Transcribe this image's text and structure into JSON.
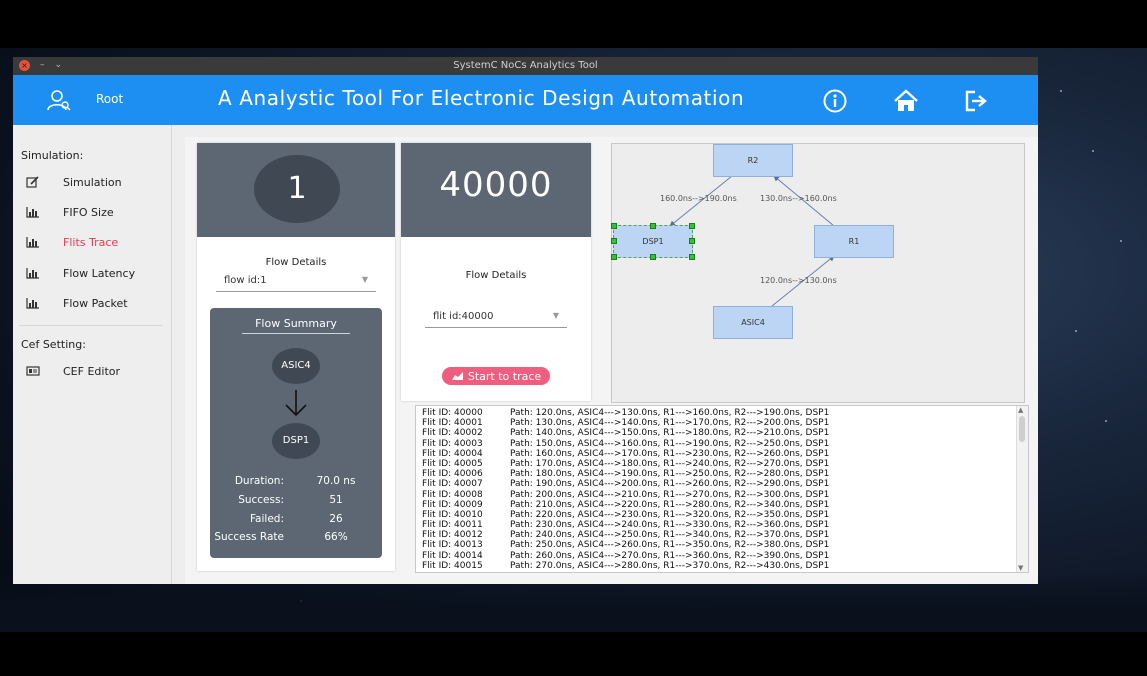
{
  "window": {
    "title": "SystemC NoCs Analytics Tool"
  },
  "header": {
    "user": "Root",
    "heading": "A Analystic Tool  For Electronic Design Automation",
    "icons": [
      "info-icon",
      "home-icon",
      "logout-icon"
    ],
    "color": "#1e8ff2"
  },
  "sidebar": {
    "simulation_title": "Simulation:",
    "items": [
      {
        "label": "Simulation",
        "icon": "edit-icon"
      },
      {
        "label": "FIFO Size",
        "icon": "bar-chart-icon"
      },
      {
        "label": "Flits Trace",
        "icon": "bar-chart-icon",
        "active": true
      },
      {
        "label": "Flow Latency",
        "icon": "bar-chart-icon"
      },
      {
        "label": "Flow Packet",
        "icon": "bar-chart-icon"
      }
    ],
    "cef_title": "Cef Setting:",
    "cef_items": [
      {
        "label": "CEF Editor",
        "icon": "editor-icon"
      }
    ],
    "active_color": "#e23d50"
  },
  "flow_card": {
    "flow_number": "1",
    "details_label": "Flow Details",
    "flow_select": "flow id:1",
    "summary": {
      "title": "Flow Summary",
      "source": "ASIC4",
      "dest": "DSP1",
      "duration_label": "Duration:",
      "duration": "70.0 ns",
      "success_label": "Success:",
      "success": "51",
      "failed_label": "Failed:",
      "failed": "26",
      "rate_label": "Success Rate",
      "rate": "66%"
    }
  },
  "flit_card": {
    "flit_number": "40000",
    "details_label": "Flow Details",
    "flit_select": "flit id:40000",
    "button": "Start to trace",
    "button_color": "#ef5e7e"
  },
  "graph": {
    "nodes": {
      "r2": "R2",
      "r1": "R1",
      "dsp1": "DSP1",
      "asic4": "ASIC4"
    },
    "edges": {
      "r2_dsp1": "160.0ns-->190.0ns",
      "r1_r2": "130.0ns-->160.0ns",
      "asic4_r1": "120.0ns-->130.0ns"
    }
  },
  "log": [
    {
      "id": "Flit ID: 40000",
      "path": "Path: 120.0ns, ASIC4--->130.0ns, R1--->160.0ns, R2--->190.0ns, DSP1"
    },
    {
      "id": "Flit ID: 40001",
      "path": "Path: 130.0ns, ASIC4--->140.0ns, R1--->170.0ns, R2--->200.0ns, DSP1"
    },
    {
      "id": "Flit ID: 40002",
      "path": "Path: 140.0ns, ASIC4--->150.0ns, R1--->180.0ns, R2--->210.0ns, DSP1"
    },
    {
      "id": "Flit ID: 40003",
      "path": "Path: 150.0ns, ASIC4--->160.0ns, R1--->190.0ns, R2--->250.0ns, DSP1"
    },
    {
      "id": "Flit ID: 40004",
      "path": "Path: 160.0ns, ASIC4--->170.0ns, R1--->230.0ns, R2--->260.0ns, DSP1"
    },
    {
      "id": "Flit ID: 40005",
      "path": "Path: 170.0ns, ASIC4--->180.0ns, R1--->240.0ns, R2--->270.0ns, DSP1"
    },
    {
      "id": "Flit ID: 40006",
      "path": "Path: 180.0ns, ASIC4--->190.0ns, R1--->250.0ns, R2--->280.0ns, DSP1"
    },
    {
      "id": "Flit ID: 40007",
      "path": "Path: 190.0ns, ASIC4--->200.0ns, R1--->260.0ns, R2--->290.0ns, DSP1"
    },
    {
      "id": "Flit ID: 40008",
      "path": "Path: 200.0ns, ASIC4--->210.0ns, R1--->270.0ns, R2--->300.0ns, DSP1"
    },
    {
      "id": "Flit ID: 40009",
      "path": "Path: 210.0ns, ASIC4--->220.0ns, R1--->280.0ns, R2--->340.0ns, DSP1"
    },
    {
      "id": "Flit ID: 40010",
      "path": "Path: 220.0ns, ASIC4--->230.0ns, R1--->320.0ns, R2--->350.0ns, DSP1"
    },
    {
      "id": "Flit ID: 40011",
      "path": "Path: 230.0ns, ASIC4--->240.0ns, R1--->330.0ns, R2--->360.0ns, DSP1"
    },
    {
      "id": "Flit ID: 40012",
      "path": "Path: 240.0ns, ASIC4--->250.0ns, R1--->340.0ns, R2--->370.0ns, DSP1"
    },
    {
      "id": "Flit ID: 40013",
      "path": "Path: 250.0ns, ASIC4--->260.0ns, R1--->350.0ns, R2--->380.0ns, DSP1"
    },
    {
      "id": "Flit ID: 40014",
      "path": "Path: 260.0ns, ASIC4--->270.0ns, R1--->360.0ns, R2--->390.0ns, DSP1"
    },
    {
      "id": "Flit ID: 40015",
      "path": "Path: 270.0ns, ASIC4--->280.0ns, R1--->370.0ns, R2--->430.0ns, DSP1"
    }
  ]
}
